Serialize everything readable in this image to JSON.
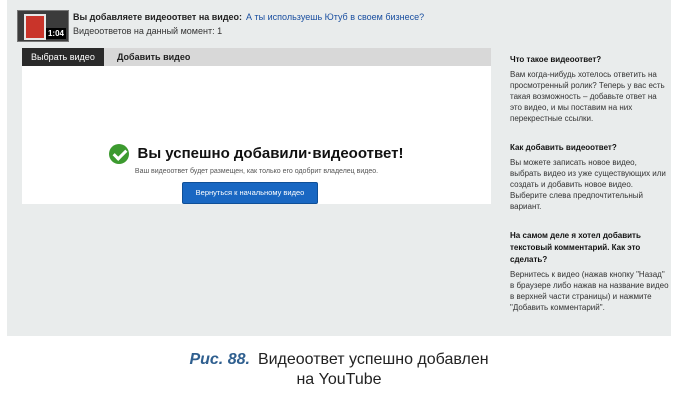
{
  "header": {
    "thumb_duration": "1:04",
    "title_prefix": "Вы добавляете видеоответ на видео:",
    "title_link": "А ты используешь Ютуб в своем бизнесе?",
    "responses_count": "Видеоответов на данный момент: 1"
  },
  "tabs": [
    {
      "label": "Выбрать видео"
    },
    {
      "label": "Добавить видео"
    }
  ],
  "success": {
    "title": "Вы успешно добавили·видеоответ!",
    "subtitle": "Ваш видеоответ будет размещен, как только его одобрит владелец видео.",
    "back_button": "Вернуться к начальному видео"
  },
  "sidebar": [
    {
      "heading": "Что такое видеоответ?",
      "text": "Вам когда-нибудь хотелось ответить на просмотренный ролик? Теперь у вас есть такая возможность – добавьте ответ на это видео, и мы поставим на них перекрестные ссылки."
    },
    {
      "heading": "Как добавить видеоответ?",
      "text": "Вы можете записать новое видео, выбрать видео из уже существующих или создать и добавить новое видео. Выберите слева предпочтительный вариант."
    },
    {
      "heading": "На самом деле я хотел добавить текстовый комментарий. Как это сделать?",
      "text": "Вернитесь к видео (нажав кнопку \"Назад\" в браузере либо нажав на название видео в верхней части страницы) и нажмите \"Добавить комментарий\"."
    }
  ],
  "caption": {
    "figure": "Рис. 88.",
    "line1": "Видеоответ успешно добавлен",
    "line2": "на YouTube"
  }
}
